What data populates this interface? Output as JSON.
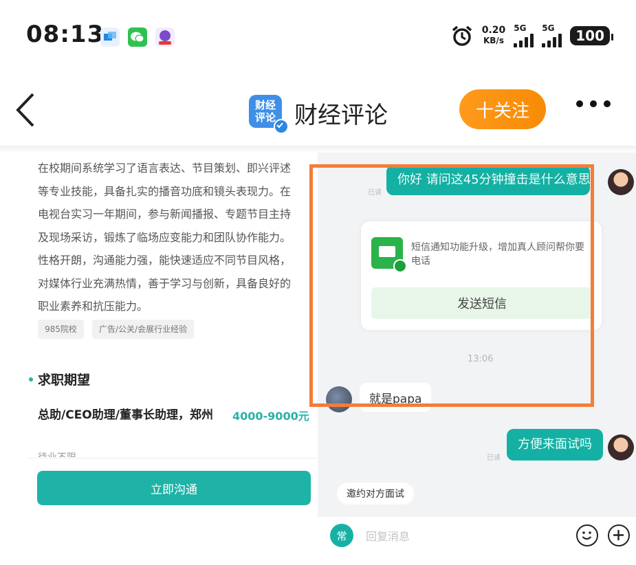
{
  "status_bar": {
    "time": "08:13",
    "net_speed": "0.20",
    "net_unit": "KB/s",
    "sim1": "5G",
    "sim2": "5G",
    "battery": "100"
  },
  "header": {
    "brand": "财经评论",
    "logo_line1": "财经",
    "logo_line2": "评论",
    "follow_label": "十关注"
  },
  "profile": {
    "resume_lines": [
      "在校期间系统学习了语言表达、节目策划、即兴评述",
      "等专业技能，具备扎实的播音功底和镜头表现力。在",
      "电视台实习一年期间，参与新闻播报、专题节目主持",
      "及现场采访，锻炼了临场应变能力和团队协作能力。",
      "性格开朗，沟通能力强，能快速适应不同节目风格，",
      "对媒体行业充满热情，善于学习与创新，具备良好的",
      "职业素养和抗压能力。"
    ],
    "tags": [
      "985院校",
      "广告/公关/会展行业经验"
    ],
    "section_title": "求职期望",
    "job_title": "总助/CEO助理/董事长助理，郑州",
    "salary": "4000-9000元",
    "cut_text": "待业不限",
    "chat_button": "立即沟通"
  },
  "chat": {
    "msg1": {
      "text": "你好 请问这45分钟撞击是什么意思",
      "status": "已读"
    },
    "card": {
      "text": "短信通知功能升级，增加真人顾问帮你要电话",
      "button": "发送短信"
    },
    "timestamp": "13:06",
    "msg_in": "就是papa",
    "msg2": {
      "text": "方便来面试吗",
      "status": "已读"
    },
    "invite_chip": "邀约对方面试",
    "input_badge": "常",
    "input_placeholder": "回复消息"
  },
  "colors": {
    "accent_orange": "#f7900f",
    "teal": "#1fb2a6",
    "highlight": "#f47d39"
  },
  "icons": [
    "back-chevron-icon",
    "more-dots-icon",
    "sms-icon",
    "emoji-icon",
    "plus-icon",
    "verified-icon"
  ]
}
